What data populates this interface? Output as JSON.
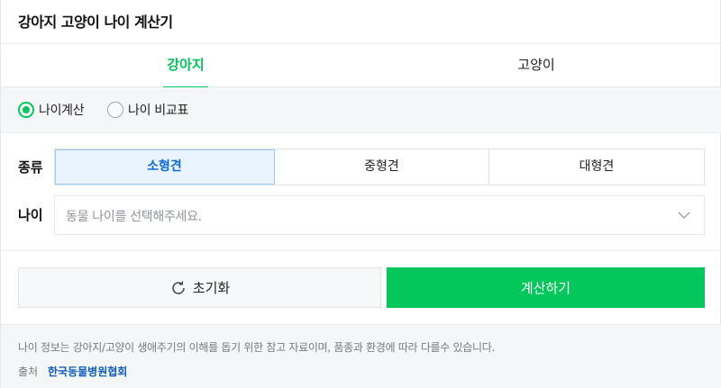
{
  "header": {
    "title": "강아지 고양이 나이 계산기"
  },
  "tabs": [
    {
      "label": "강아지",
      "active": true
    },
    {
      "label": "고양이",
      "active": false
    }
  ],
  "modes": [
    {
      "label": "나이계산",
      "checked": true
    },
    {
      "label": "나이 비교표",
      "checked": false
    }
  ],
  "kind": {
    "label": "종류",
    "options": [
      "소형견",
      "중형견",
      "대형견"
    ],
    "selected": "소형견"
  },
  "age": {
    "label": "나이",
    "placeholder": "동물 나이를 선택해주세요."
  },
  "buttons": {
    "reset": "초기화",
    "calculate": "계산하기"
  },
  "footer": {
    "note": "나이 정보는 강아지/고양이 생애주기의 이해를 돕기 위한 참고 자료이며, 품종과 환경에 따라 다를수 있습니다.",
    "source_label": "출처",
    "source_name": "한국동물병원협회"
  },
  "colors": {
    "accent": "#03c75a",
    "selected_bg": "#e9f4fe",
    "selected_text": "#0b6cd8",
    "link": "#0b5cb8"
  },
  "icons": {
    "select_chevron": "chevron-down-icon",
    "reset": "refresh-icon"
  }
}
